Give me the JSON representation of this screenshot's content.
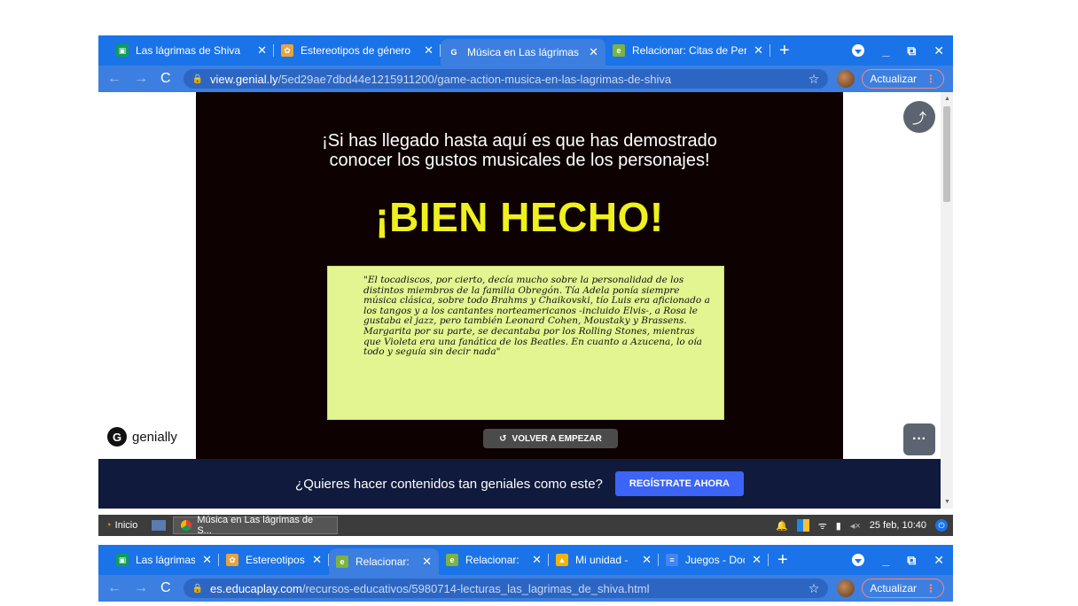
{
  "window1": {
    "tabs": [
      {
        "title": "Las lágrimas de Shiva",
        "fav_color": "#0f9d58",
        "fav_glyph": "▣",
        "active": false
      },
      {
        "title": "Estereotipos de género",
        "fav_color": "#e8a33d",
        "fav_glyph": "✿",
        "active": false
      },
      {
        "title": "Música en Las lágrimas",
        "fav_color": "#3c7fe0",
        "fav_glyph": "G",
        "active": true
      },
      {
        "title": "Relacionar: Citas de Per",
        "fav_color": "#7cb342",
        "fav_glyph": "e",
        "active": false
      }
    ],
    "new_tab": "+",
    "url_domain": "view.genial.ly",
    "url_path": "/5ed29ae7dbd44e1215911200/game-action-musica-en-las-lagrimas-de-shiva",
    "update_label": "Actualizar",
    "page": {
      "headline_line1": "¡Si has llegado hasta aquí es que has demostrado",
      "headline_line2": "conocer los gustos musicales de los personajes!",
      "big_text": "¡BIEN HECHO!",
      "quote": "\"El tocadiscos, por cierto, decía mucho sobre la personalidad de los distintos miembros de la familia Obregón. Tía Adela ponía siempre música clásica, sobre todo Brahms y Chaikovski, tío Luis era aficionado a los tangos y a los cantantes norteamericanos -incluido Elvis-, a Rosa le gustaba el jazz, pero también Leonard Cohen, Moustaky y Brassens. Margarita por su parte, se decantaba por los Rolling Stones, mientras que Violeta era una fanática de los Beatles. En cuanto a Azucena, lo oía todo y seguía sin decir nada\"",
      "restart_label": "VOLVER A EMPEZAR",
      "logo_text": "genially",
      "banner_msg": "¿Quieres hacer contenidos tan geniales como este?",
      "banner_cta": "REGÍSTRATE AHORA"
    }
  },
  "taskbar": {
    "start_label": "Inicio",
    "window_label": "Música en Las lágrimas de S...",
    "clock": "25 feb, 10:40"
  },
  "window2": {
    "tabs": [
      {
        "title": "Las lágrimas",
        "fav_color": "#0f9d58",
        "fav_glyph": "▣",
        "active": false
      },
      {
        "title": "Estereotipos",
        "fav_color": "#e8a33d",
        "fav_glyph": "✿",
        "active": false
      },
      {
        "title": "Relacionar:",
        "fav_color": "#7cb342",
        "fav_glyph": "e",
        "active": true
      },
      {
        "title": "Relacionar:",
        "fav_color": "#7cb342",
        "fav_glyph": "e",
        "active": false
      },
      {
        "title": "Mi unidad -",
        "fav_color": "#f4b400",
        "fav_glyph": "▲",
        "active": false
      },
      {
        "title": "Juegos - Doc",
        "fav_color": "#4285f4",
        "fav_glyph": "≡",
        "active": false
      }
    ],
    "new_tab": "+",
    "url_domain": "es.educaplay.com",
    "url_path": "/recursos-educativos/5980714-lecturas_las_lagrimas_de_shiva.html",
    "update_label": "Actualizar"
  },
  "colors": {
    "chrome_blue": "#1a73e8",
    "stage_bg": "#0d0101",
    "big_text": "#eef11e",
    "quote_bg": "#e3f590",
    "banner_bg": "#101a3c",
    "cta_bg": "#3c64f6"
  }
}
